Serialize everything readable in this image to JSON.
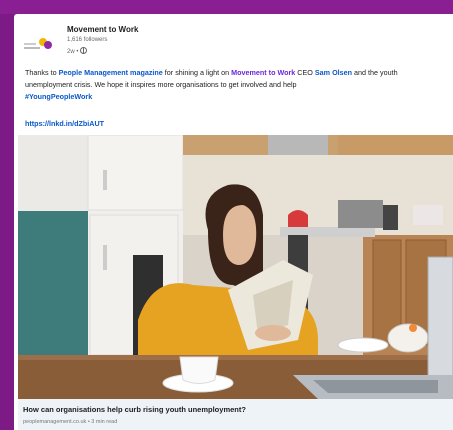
{
  "post": {
    "org_name": "Movement to Work",
    "followers": "1,616 followers",
    "time": "2w •",
    "text_before": "Thanks to ",
    "mention_magazine": "People Management magazine",
    "text_mid1": " for shining a light on ",
    "mention_org": "Movement to Work",
    "text_mid2": " CEO ",
    "mention_person": "Sam Olsen",
    "text_after": " and the youth unemployment crisis. We hope it inspires more organisations to get involved and help ",
    "hashtag": "#YoungPeopleWork",
    "short_url": "https://lnkd.in/dZbiAUT"
  },
  "article": {
    "title": "How can organisations help curb rising youth unemployment?",
    "meta": "peoplemanagement.co.uk • 3 min read"
  },
  "colors": {
    "frame": "#7d1a86",
    "link": "#0a58ca",
    "mention": "#6d28d9",
    "caption_bg": "#eef3f8"
  },
  "icons": {
    "logo": "movement-to-work-logo",
    "visibility": "globe-icon"
  }
}
